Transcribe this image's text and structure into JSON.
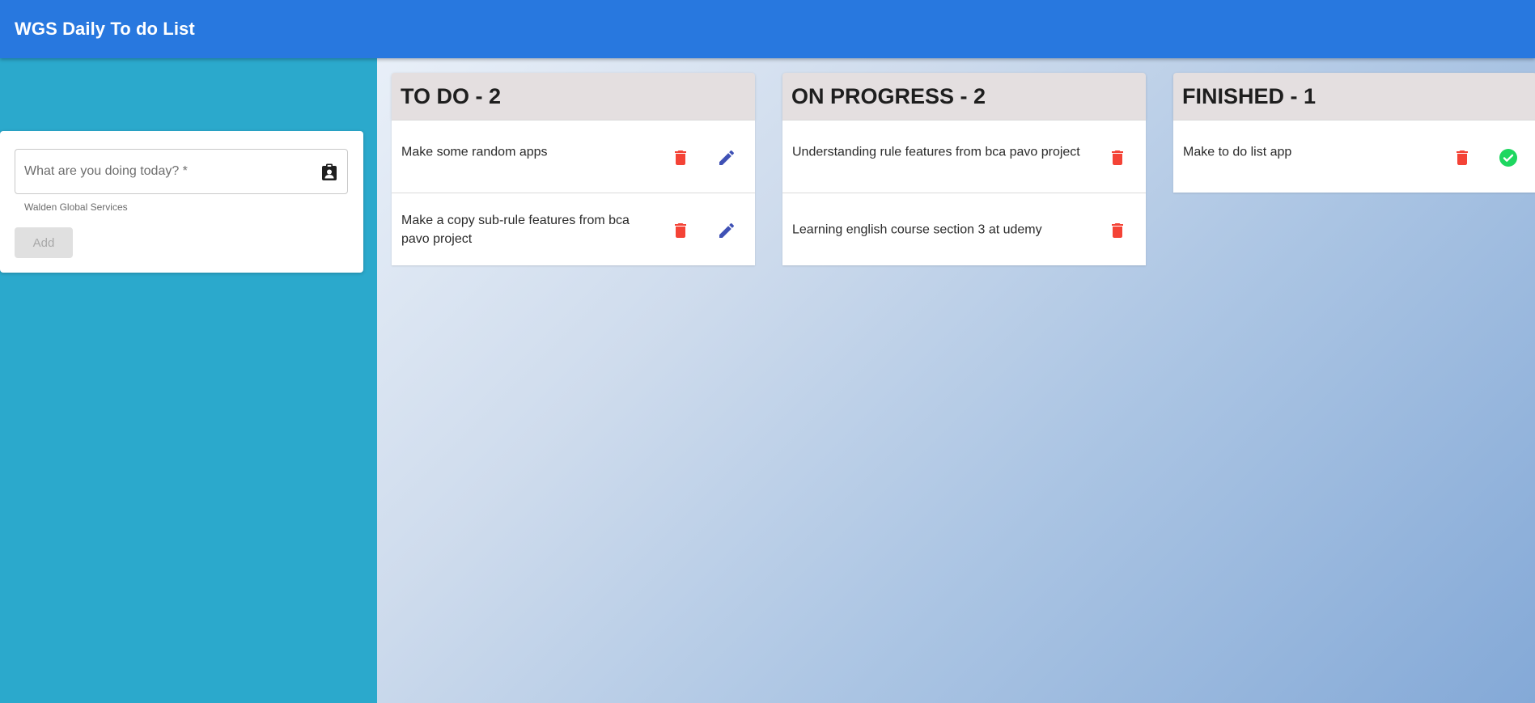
{
  "app": {
    "title": "WGS Daily To do List"
  },
  "form": {
    "input_placeholder": "What are you doing today? *",
    "input_value": "",
    "helper_text": "Walden Global Services",
    "add_label": "Add",
    "input_icon": "clipboard-account-icon"
  },
  "columns": [
    {
      "title": "TO DO - 2",
      "tasks": [
        {
          "text": "Make some random apps",
          "actions": [
            "delete-icon",
            "edit-icon"
          ]
        },
        {
          "text": "Make a copy sub-rule features from bca pavo project",
          "actions": [
            "delete-icon",
            "edit-icon"
          ]
        }
      ]
    },
    {
      "title": "ON PROGRESS - 2",
      "tasks": [
        {
          "text": "Understanding rule features from bca pavo project",
          "actions": [
            "delete-icon"
          ]
        },
        {
          "text": "Learning english course section 3 at udemy",
          "actions": [
            "delete-icon"
          ]
        }
      ]
    },
    {
      "title": "FINISHED - 1",
      "tasks": [
        {
          "text": "Make to do list app",
          "actions": [
            "delete-icon",
            "check-circle-icon"
          ]
        }
      ]
    }
  ],
  "colors": {
    "appbar": "#2878df",
    "sidebar": "#2ba9cc",
    "delete": "#f44336",
    "edit": "#3f51b5",
    "done": "#1ed760"
  }
}
